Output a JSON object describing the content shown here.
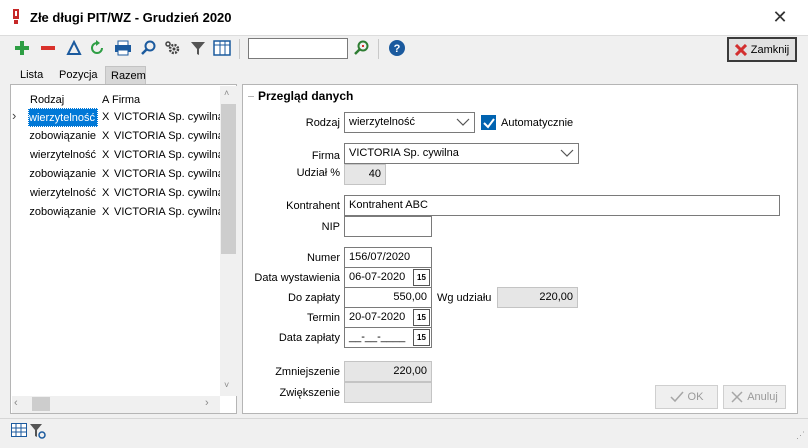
{
  "window": {
    "title": "Złe długi PIT/WZ - Grudzień 2020"
  },
  "toolbar": {
    "icons": [
      "add-icon",
      "remove-icon",
      "edit-icon",
      "refresh-icon",
      "print-icon",
      "search-icon",
      "settings-icon",
      "filter-icon",
      "columns-icon",
      "find-icon",
      "help-icon"
    ],
    "search_value": "",
    "close_label": "Zamknij"
  },
  "tabs": [
    "Lista",
    "Pozycja",
    "Razem"
  ],
  "list": {
    "columns": [
      "Rodzaj",
      "A",
      "Firma"
    ],
    "rows": [
      {
        "rodzaj": "wierzytelność",
        "a": "X",
        "firma": "VICTORIA Sp. cywilna"
      },
      {
        "rodzaj": "zobowiązanie",
        "a": "X",
        "firma": "VICTORIA Sp. cywilna"
      },
      {
        "rodzaj": "wierzytelność",
        "a": "X",
        "firma": "VICTORIA Sp. cywilna"
      },
      {
        "rodzaj": "zobowiązanie",
        "a": "X",
        "firma": "VICTORIA Sp. cywilna"
      },
      {
        "rodzaj": "wierzytelność",
        "a": "X",
        "firma": "VICTORIA Sp. cywilna"
      },
      {
        "rodzaj": "zobowiązanie",
        "a": "X",
        "firma": "VICTORIA Sp. cywilna"
      }
    ]
  },
  "form": {
    "group_title": "Przegląd danych",
    "rodzaj_label": "Rodzaj",
    "rodzaj_value": "wierzytelność",
    "auto_label": "Automatycznie",
    "firma_label": "Firma",
    "firma_value": "VICTORIA Sp. cywilna",
    "udzial_label": "Udział %",
    "udzial_value": "40",
    "kontrahent_label": "Kontrahent",
    "kontrahent_value": "Kontrahent ABC",
    "nip_label": "NIP",
    "nip_value": "",
    "numer_label": "Numer",
    "numer_value": "156/07/2020",
    "data_wyst_label": "Data wystawienia",
    "data_wyst_value": "06-07-2020",
    "do_zaplaty_label": "Do zapłaty",
    "do_zaplaty_value": "550,00",
    "wg_udzialu_label": "Wg udziału",
    "wg_udzialu_value": "220,00",
    "termin_label": "Termin",
    "termin_value": "20-07-2020",
    "data_zaplaty_label": "Data zapłaty",
    "data_zaplaty_value": "__-__-____",
    "calendar_glyph": "15",
    "zmniejszenie_label": "Zmniejszenie",
    "zmniejszenie_value": "220,00",
    "zwiekszenie_label": "Zwiększenie",
    "zwiekszenie_value": "",
    "ok_label": "OK",
    "anuluj_label": "Anuluj"
  },
  "colors": {
    "accent": "#0063b1",
    "selection": "#0078d7",
    "add": "#2e9e44",
    "remove": "#d9312b",
    "close": "#d32f2f"
  }
}
